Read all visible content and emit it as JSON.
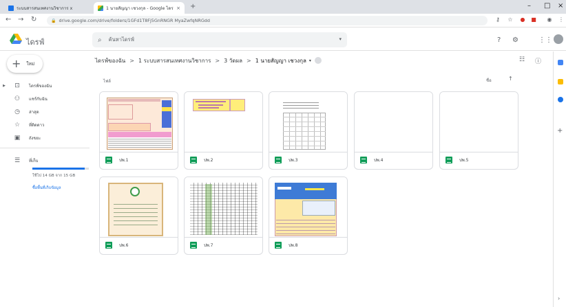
{
  "browser": {
    "tabs": [
      {
        "title": "ระบบสารสนเทศงานวิชาการ x"
      },
      {
        "title": "1 นายสัญญา เชวงกุล - Google ไดรฟ์"
      }
    ],
    "new_tab": "+",
    "url": "drive.google.com/drive/folders/1GFd1T8Fj5GnRNGR MyaZwfqNRGdd",
    "window_controls": {
      "minimize": "–",
      "maximize": "□",
      "close": "×"
    }
  },
  "header": {
    "brand": "ไดรฟ์",
    "search_placeholder": "ค้นหาไดรฟ์"
  },
  "sidebar": {
    "new_button": "ใหม่",
    "items": [
      {
        "label": "ไดรฟ์ของฉัน",
        "icon": "drive-icon"
      },
      {
        "label": "แชร์กับฉัน",
        "icon": "people-icon"
      },
      {
        "label": "ล่าสุด",
        "icon": "clock-icon"
      },
      {
        "label": "ที่ติดดาว",
        "icon": "star-icon"
      },
      {
        "label": "ถังขยะ",
        "icon": "trash-icon"
      }
    ],
    "storage": {
      "label": "ที่เก็บ",
      "used_text": "ใช้ไป 14 GB จาก 15 GB",
      "fraction": 0.93,
      "buy_link": "ซื้อพื้นที่เก็บข้อมูล"
    }
  },
  "breadcrumb": {
    "items": [
      "ไดรฟ์ของฉัน",
      "1 ระบบสารสนเทศงานวิชาการ",
      "3 วัดผล",
      "1 นายสัญญา เชวงกุล"
    ],
    "separator": ">",
    "caret": "▾"
  },
  "section": {
    "title": "ไฟล์",
    "sort_label": "ชื่อ",
    "sort_arrow": "↑"
  },
  "files": [
    {
      "name": "ปพ.1"
    },
    {
      "name": "ปพ.2"
    },
    {
      "name": "ปพ.3"
    },
    {
      "name": "ปพ.4"
    },
    {
      "name": "ปพ.5"
    },
    {
      "name": "ปพ.6"
    },
    {
      "name": "ปพ.7"
    },
    {
      "name": "ปพ.8"
    }
  ],
  "colors": {
    "accent": "#1a73e8",
    "sheets": "#0f9d58",
    "drive_yellow": "#fbbc04",
    "drive_green": "#34a853",
    "drive_blue": "#4285f4"
  }
}
